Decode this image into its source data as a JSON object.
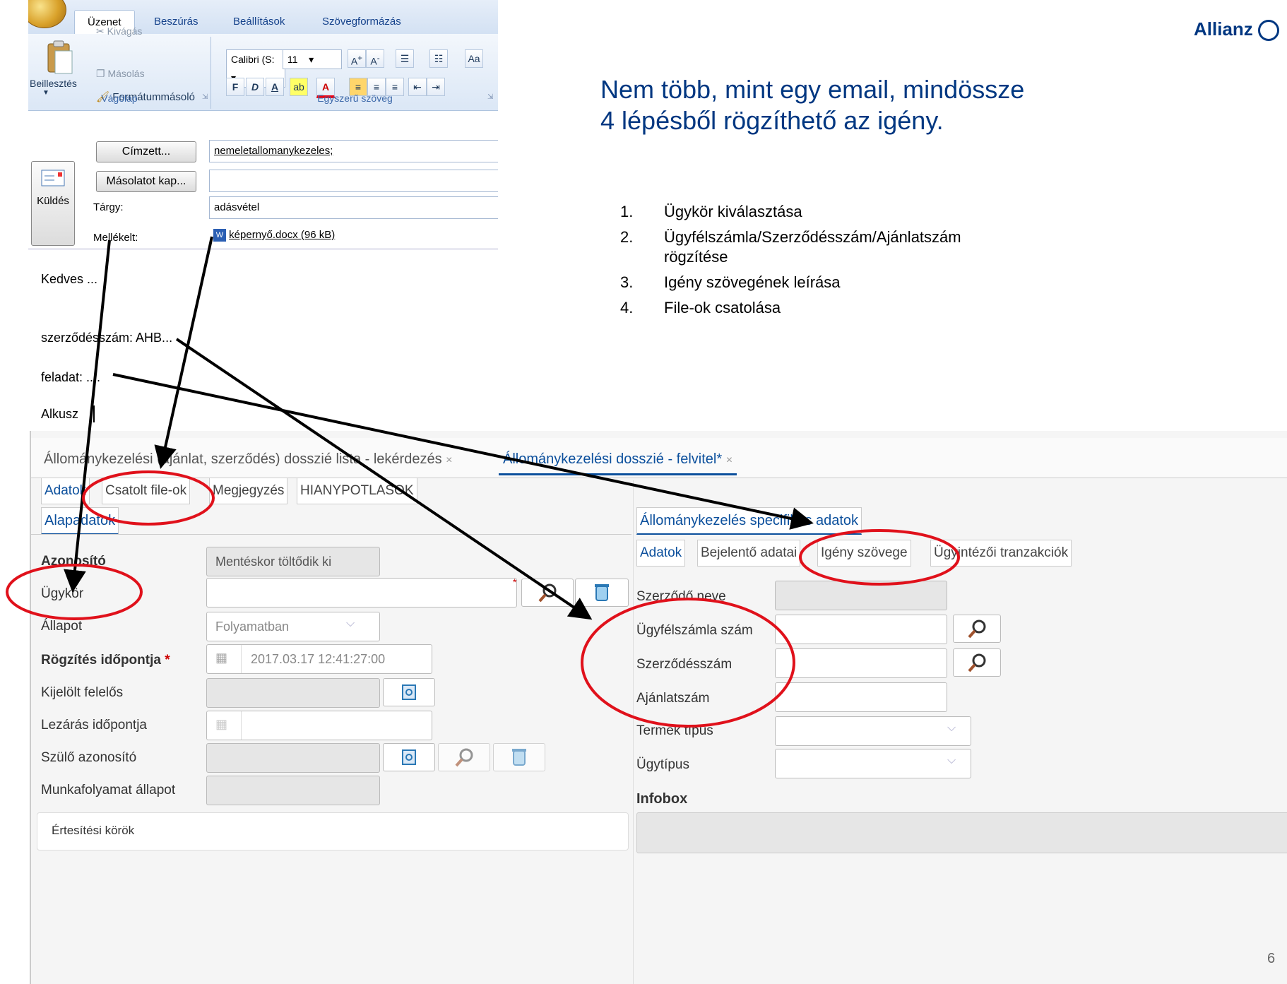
{
  "outlook": {
    "tabs": [
      "Üzenet",
      "Beszúrás",
      "Beállítások",
      "Szövegformázás"
    ],
    "clipboard": {
      "paste": "Beillesztés",
      "cut": "Kivágás",
      "copy": "Másolás",
      "format_painter": "Formátummásoló",
      "group_label": "Vágólap"
    },
    "basic_text": {
      "font_name": "Calibri (S:",
      "font_size": "11",
      "group_label": "Egyszerű szöveg",
      "bold": "F",
      "italic": "D",
      "underline": "A"
    },
    "send_label": "Küldés",
    "to_button": "Címzett...",
    "cc_button": "Másolatot kap...",
    "to_value": "nemeletallomanykezeles;",
    "cc_value": "",
    "subject_label": "Tárgy:",
    "subject_value": "adásvétel",
    "attached_label": "Mellékelt:",
    "attachment": "képernyő.docx (96 kB)",
    "body_lines": [
      "Kedves ...",
      "szerződésszám: AHB...",
      "feladat: ....",
      "Alkusz"
    ]
  },
  "brand": "Allianz",
  "headline": [
    "Nem több, mint egy email, mindössze",
    "4 lépésből rögzíthető az igény."
  ],
  "steps": [
    {
      "num": "1.",
      "lines": [
        "Ügykör kiválasztása"
      ]
    },
    {
      "num": "2.",
      "lines": [
        "Ügyfélszámla/Szerződésszám/Ajánlatszám",
        "rögzítése"
      ]
    },
    {
      "num": "3.",
      "lines": [
        "Igény szövegének leírása"
      ]
    },
    {
      "num": "4.",
      "lines": [
        "File-ok csatolása"
      ]
    }
  ],
  "app": {
    "main_tabs": [
      {
        "label": "Állománykezelési (ajánlat, szerződés) dosszié lista - lekérdezés",
        "close": "×"
      },
      {
        "label": "Állománykezelési dosszié - felvitel*",
        "close": "×"
      }
    ],
    "sub_tabs": [
      "Adatok",
      "Csatolt file-ok",
      "Megjegyzés",
      "HIANYPOTLASOK"
    ],
    "left_section": "Alapadatok",
    "left_fields": [
      {
        "label": "Azonosító",
        "value": "Mentéskor töltődik ki"
      },
      {
        "label": "Ügykör",
        "value": ""
      },
      {
        "label": "Állapot",
        "value": "Folyamatban"
      },
      {
        "label": "Rögzítés időpontja",
        "value": "2017.03.17 12:41:27:00",
        "required": "*"
      },
      {
        "label": "Kijelölt felelős",
        "value": ""
      },
      {
        "label": "Lezárás időpontja",
        "value": ""
      },
      {
        "label": "Szülő azonosító",
        "value": ""
      },
      {
        "label": "Munkafolyamat állapot",
        "value": ""
      }
    ],
    "notification": "Értesítési körök",
    "right_section": "Állománykezelés specifikus adatok",
    "right_tabs": [
      "Adatok",
      "Bejelentő adatai",
      "Igény szövege",
      "Ügyintézői tranzakciók"
    ],
    "right_fields": [
      {
        "label": "Szerződő neve"
      },
      {
        "label": "Ügyfélszámla szám"
      },
      {
        "label": "Szerződésszám"
      },
      {
        "label": "Ajánlatszám"
      },
      {
        "label": "Termék típus"
      },
      {
        "label": "Ügytípus"
      }
    ],
    "infobox": "Infobox",
    "required_mark": "*"
  },
  "slide_number": "6",
  "colors": {
    "brand": "#003781",
    "annotation_red": "#e0111b",
    "arrow": "#000000",
    "tab_active": "#0b4f9c"
  }
}
